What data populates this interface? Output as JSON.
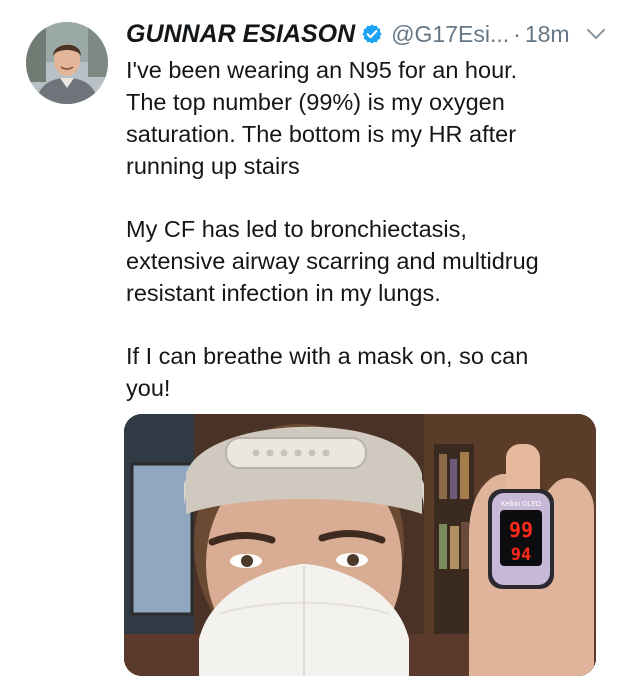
{
  "tweet": {
    "author": {
      "display_name": "GUNNAR ESIASON",
      "handle": "@G17Esi...",
      "separator": "·",
      "timestamp": "18m",
      "verified": true
    },
    "text": {
      "p1_l1": "I've been wearing an N95 for an hour.",
      "p1_l2": "The top number (99%) is my oxygen",
      "p1_l3": "saturation. The bottom is my HR after",
      "p1_l4": "running up stairs",
      "p2_l1": "My CF has led to bronchiectasis,",
      "p2_l2": "extensive airway scarring and multidrug",
      "p2_l3": "resistant infection in my lungs.",
      "p3_l1": "If I can breathe with a mask on, so can",
      "p3_l2": "you!"
    },
    "media": {
      "oximeter_spo2": "99",
      "oximeter_hr": "94",
      "oximeter_brand": "Kelkin  OLED"
    },
    "colors": {
      "verified_blue": "#1da1f2",
      "secondary_text": "#657786",
      "oximeter_led": "#ff2a1a"
    },
    "icons": [
      "verified-badge-icon",
      "chevron-down-icon"
    ]
  }
}
